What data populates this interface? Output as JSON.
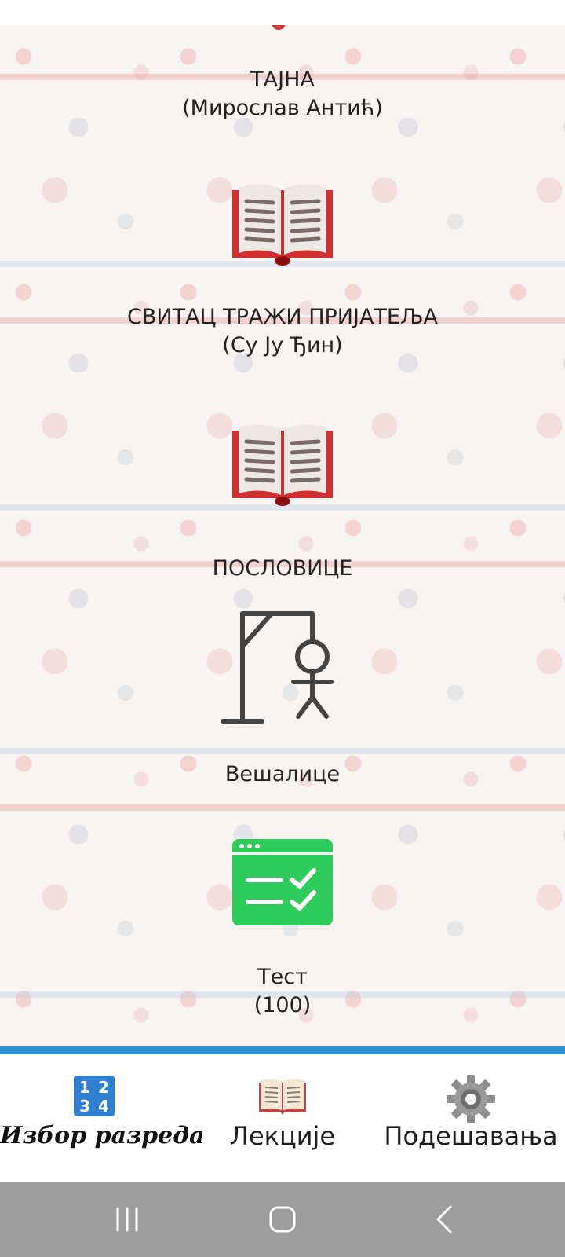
{
  "lessons": [
    {
      "title": "ТАЈНА",
      "subtitle": "(Мирослав Антић)",
      "icon": "open-book-icon"
    },
    {
      "title": "СВИТАЦ ТРАЖИ ПРИЈАТЕЉА",
      "subtitle": "(Су Ју Ђин)",
      "icon": "open-book-icon"
    },
    {
      "title": "ПОСЛОВИЦЕ",
      "icon": "hangman-icon"
    },
    {
      "title": "Вешалице",
      "icon": "test-checklist-icon"
    },
    {
      "title": "Тест",
      "subtitle": "(100)"
    }
  ],
  "bottom_nav": {
    "items": [
      {
        "label": "Избор разреда",
        "icon": "numbers-1234-icon",
        "active": true
      },
      {
        "label": "Лекције",
        "icon": "book-icon",
        "active": false
      },
      {
        "label": "Подешавања",
        "icon": "gear-icon",
        "active": false
      }
    ]
  },
  "system_nav": {
    "buttons": [
      "recent-apps-icon",
      "home-icon",
      "back-icon"
    ]
  },
  "colors": {
    "accent_stripe": "#2f8fd8",
    "book_red": "#d32f2f",
    "test_green": "#2ecc5a",
    "system_nav_bg": "#9d9d9d"
  }
}
